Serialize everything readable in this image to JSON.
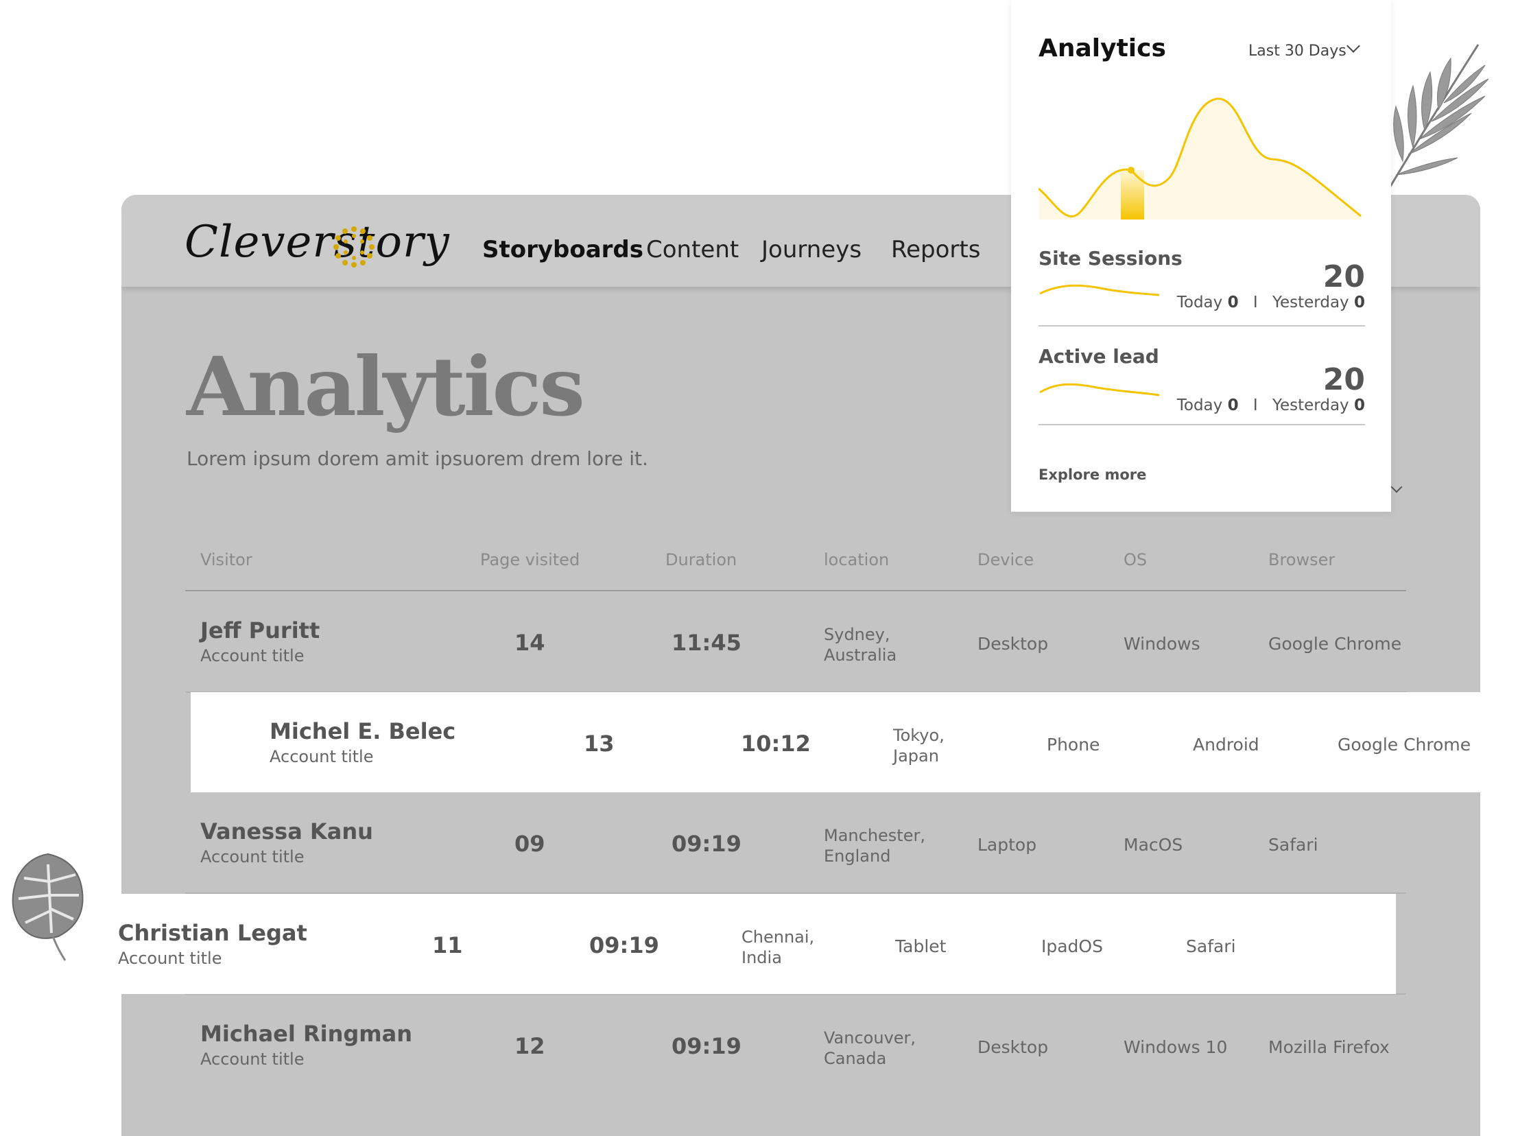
{
  "header": {
    "logo_text": "Cleverstory",
    "nav": [
      {
        "label": "Storyboards",
        "active": true
      },
      {
        "label": "Content",
        "active": false
      },
      {
        "label": "Journeys",
        "active": false
      },
      {
        "label": "Reports",
        "active": false
      }
    ]
  },
  "page": {
    "title": "Analytics",
    "subtitle": "Lorem ipsum dorem amit ipsuorem drem lore it."
  },
  "table": {
    "columns": [
      "Visitor",
      "Page visited",
      "Duration",
      "location",
      "Device",
      "OS",
      "Browser"
    ],
    "rows": [
      {
        "name": "Jeff Puritt",
        "account": "Account title",
        "pages": "14",
        "duration": "11:45",
        "location_line1": "Sydney,",
        "location_line2": "Australia",
        "device": "Desktop",
        "os": "Windows",
        "browser": "Google Chrome"
      },
      {
        "name": "Michel E. Belec",
        "account": "Account title",
        "pages": "13",
        "duration": "10:12",
        "location_line1": "Tokyo,",
        "location_line2": "Japan",
        "device": "Phone",
        "os": "Android",
        "browser": "Google Chrome"
      },
      {
        "name": "Vanessa Kanu",
        "account": "Account title",
        "pages": "09",
        "duration": "09:19",
        "location_line1": "Manchester,",
        "location_line2": "England",
        "device": "Laptop",
        "os": "MacOS",
        "browser": "Safari"
      },
      {
        "name": "Christian Legat",
        "account": "Account title",
        "pages": "11",
        "duration": "09:19",
        "location_line1": "Chennai,",
        "location_line2": "India",
        "device": "Tablet",
        "os": "IpadOS",
        "browser": "Safari"
      },
      {
        "name": "Michael Ringman",
        "account": "Account title",
        "pages": "12",
        "duration": "09:19",
        "location_line1": "Vancouver,",
        "location_line2": "Canada",
        "device": "Desktop",
        "os": "Windows 10",
        "browser": "Mozilla Firefox"
      }
    ]
  },
  "card": {
    "title": "Analytics",
    "range": "Last 30 Days",
    "metrics": [
      {
        "label": "Site Sessions",
        "value": "20",
        "today_label": "Today",
        "today": "0",
        "sep": "I",
        "yesterday_label": "Yesterday",
        "yesterday": "0"
      },
      {
        "label": "Active lead",
        "value": "20",
        "today_label": "Today",
        "today": "0",
        "sep": "I",
        "yesterday_label": "Yesterday",
        "yesterday": "0"
      }
    ],
    "explore": "Explore more"
  },
  "colors": {
    "accent": "#f5c400",
    "frame": "#c4c4c4",
    "topbar": "#cbcbcb"
  },
  "icons": [
    "chevron-down-icon",
    "palm-leaf-decoration",
    "monstera-leaf-decoration"
  ]
}
